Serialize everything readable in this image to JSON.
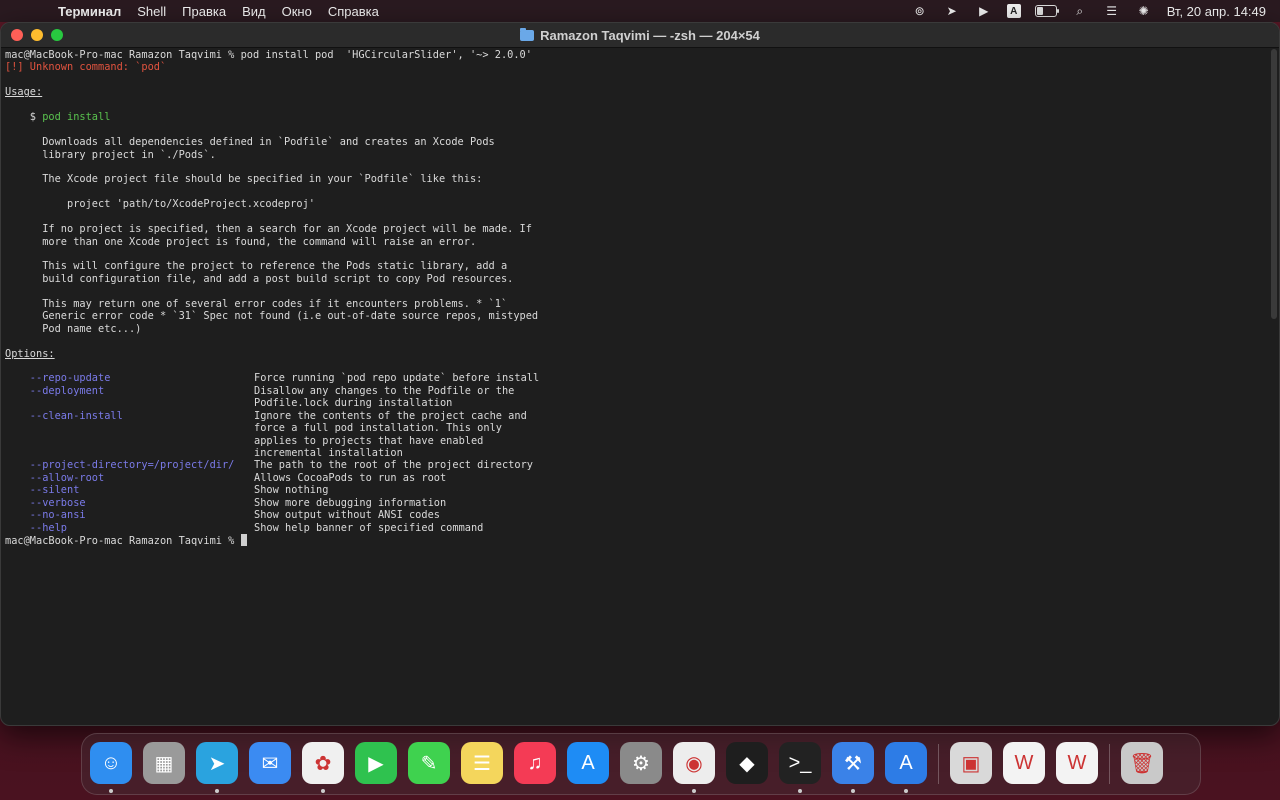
{
  "menubar": {
    "apple": "",
    "items": [
      "Терминал",
      "Shell",
      "Правка",
      "Вид",
      "Окно",
      "Справка"
    ],
    "lang": "A",
    "clock": "Вт, 20 апр.  14:49"
  },
  "window": {
    "title": "Ramazon Taqvimi — -zsh — 204×54"
  },
  "terminal": {
    "prompt_cmd": "mac@MacBook-Pro-mac Ramazon Taqvimi % pod install pod  'HGCircularSlider', '~> 2.0.0'",
    "error": "[!] Unknown command: `pod`",
    "usage_label": "Usage:",
    "usage_dollar": "    $ ",
    "usage_cmd": "pod install",
    "desc": [
      "      Downloads all dependencies defined in `Podfile` and creates an Xcode Pods",
      "      library project in `./Pods`.",
      "",
      "      The Xcode project file should be specified in your `Podfile` like this:",
      "",
      "          project 'path/to/XcodeProject.xcodeproj'",
      "",
      "      If no project is specified, then a search for an Xcode project will be made. If",
      "      more than one Xcode project is found, the command will raise an error.",
      "",
      "      This will configure the project to reference the Pods static library, add a",
      "      build configuration file, and add a post build script to copy Pod resources.",
      "",
      "      This may return one of several error codes if it encounters problems. * `1`",
      "      Generic error code * `31` Spec not found (i.e out-of-date source repos, mistyped",
      "      Pod name etc...)"
    ],
    "options_label": "Options:",
    "options": [
      {
        "name": "--repo-update",
        "desc": "Force running `pod repo update` before install"
      },
      {
        "name": "--deployment",
        "desc": "Disallow any changes to the Podfile or the"
      },
      {
        "name": "",
        "desc": "Podfile.lock during installation"
      },
      {
        "name": "--clean-install",
        "desc": "Ignore the contents of the project cache and"
      },
      {
        "name": "",
        "desc": "force a full pod installation. This only"
      },
      {
        "name": "",
        "desc": "applies to projects that have enabled"
      },
      {
        "name": "",
        "desc": "incremental installation"
      },
      {
        "name": "--project-directory=/project/dir/",
        "desc": "The path to the root of the project directory"
      },
      {
        "name": "--allow-root",
        "desc": "Allows CocoaPods to run as root"
      },
      {
        "name": "--silent",
        "desc": "Show nothing"
      },
      {
        "name": "--verbose",
        "desc": "Show more debugging information"
      },
      {
        "name": "--no-ansi",
        "desc": "Show output without ANSI codes"
      },
      {
        "name": "--help",
        "desc": "Show help banner of specified command"
      }
    ],
    "final_prompt": "mac@MacBook-Pro-mac Ramazon Taqvimi % "
  },
  "dock": {
    "apps": [
      {
        "name": "finder",
        "color": "#2f8ef0"
      },
      {
        "name": "launchpad",
        "color": "#9a9a9a"
      },
      {
        "name": "telegram",
        "color": "#2aa3df"
      },
      {
        "name": "mail",
        "color": "#3b8bf2"
      },
      {
        "name": "photos",
        "color": "#f0f0f0"
      },
      {
        "name": "facetime",
        "color": "#2fc24f"
      },
      {
        "name": "messages",
        "color": "#3fd24f"
      },
      {
        "name": "notes",
        "color": "#f4d65c"
      },
      {
        "name": "music",
        "color": "#f43b55"
      },
      {
        "name": "app-store",
        "color": "#1e8cf5"
      },
      {
        "name": "system-preferences",
        "color": "#8a8a8a"
      },
      {
        "name": "chrome",
        "color": "#ededed"
      },
      {
        "name": "figma",
        "color": "#1e1e1e"
      },
      {
        "name": "terminal",
        "color": "#222222"
      },
      {
        "name": "xcode",
        "color": "#3a82e8"
      },
      {
        "name": "simulator",
        "color": "#2d7ce6"
      },
      {
        "name": "preview",
        "color": "#d9d9d9"
      },
      {
        "name": "wps-office",
        "color": "#f3f3f3"
      },
      {
        "name": "wps-office-2",
        "color": "#f3f3f3"
      },
      {
        "name": "trash",
        "color": "#c9c9c9"
      }
    ]
  }
}
